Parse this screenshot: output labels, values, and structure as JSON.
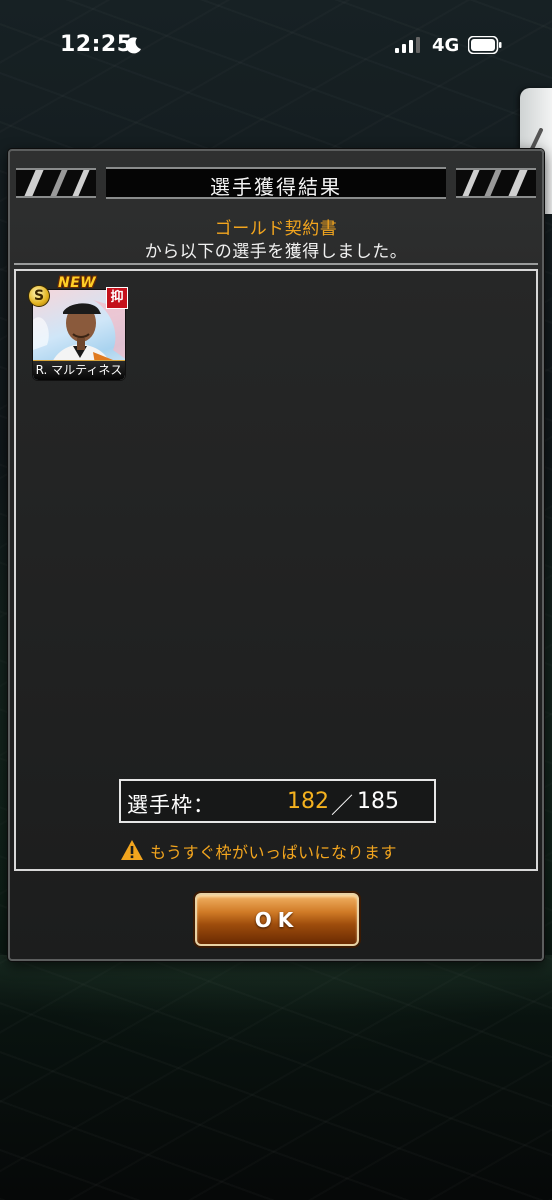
{
  "status_bar": {
    "time": "12:25",
    "network": "4G"
  },
  "dialog": {
    "title": "選手獲得結果",
    "source": "ゴールド契約書",
    "message": "から以下の選手を獲得しました。",
    "players": [
      {
        "name": "R. マルティネス",
        "rank": "S",
        "new_label": "NEW",
        "position": "抑"
      }
    ],
    "slots": {
      "label": "選手枠：",
      "current": "182",
      "separator": "／",
      "max": "185"
    },
    "warning": "もうすぐ枠がいっぱいになります",
    "ok_label": "OK"
  },
  "colors": {
    "accent_orange": "#f2a51e",
    "slot_highlight": "#f5b21f",
    "position_badge": "#c4111b"
  }
}
